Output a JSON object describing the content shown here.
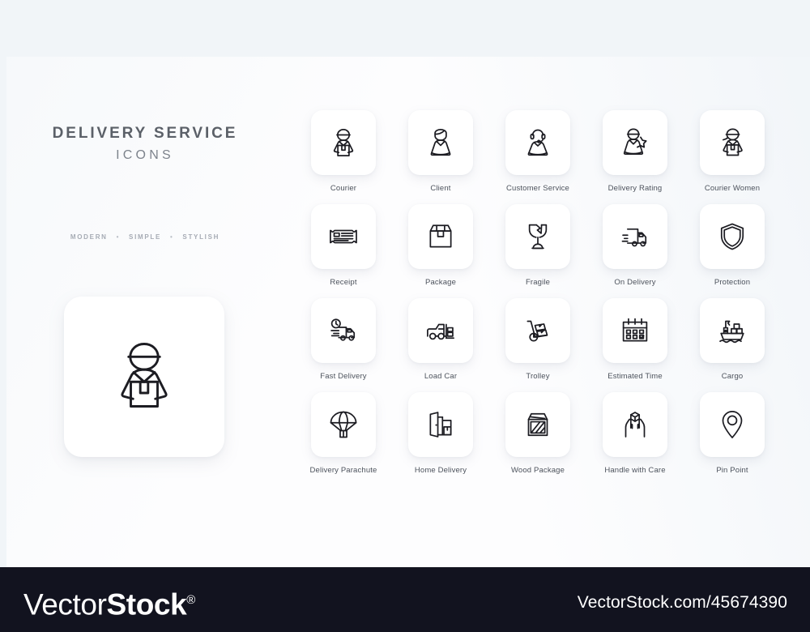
{
  "palette": {
    "top_band": "#f1f5f8",
    "canvas": "#fdfdfe",
    "tile": "#ffffff",
    "stroke": "#1c1c22",
    "label": "#4c525c",
    "title": "#5b6068",
    "footer_bg": "#12131f",
    "footer_text": "#ffffff"
  },
  "promo": {
    "title": "DELIVERY SERVICE",
    "subtitle": "ICONS",
    "tags": [
      "MODERN",
      "SIMPLE",
      "STYLISH"
    ],
    "separator": "•",
    "hero_icon_name": "courier-icon"
  },
  "grid": {
    "columns": 5,
    "rows": 4,
    "items": [
      {
        "label": "Courier",
        "icon": "courier-icon"
      },
      {
        "label": "Client",
        "icon": "client-icon"
      },
      {
        "label": "Customer Service",
        "icon": "customer-service-icon"
      },
      {
        "label": "Delivery Rating",
        "icon": "delivery-rating-icon"
      },
      {
        "label": "Courier Women",
        "icon": "courier-women-icon"
      },
      {
        "label": "Receipt",
        "icon": "receipt-icon"
      },
      {
        "label": "Package",
        "icon": "package-icon"
      },
      {
        "label": "Fragile",
        "icon": "fragile-icon"
      },
      {
        "label": "On Delivery",
        "icon": "on-delivery-truck-icon"
      },
      {
        "label": "Protection",
        "icon": "shield-icon"
      },
      {
        "label": "Fast Delivery",
        "icon": "fast-delivery-truck-icon"
      },
      {
        "label": "Load Car",
        "icon": "load-car-icon"
      },
      {
        "label": "Trolley",
        "icon": "trolley-icon"
      },
      {
        "label": "Estimated Time",
        "icon": "calendar-icon"
      },
      {
        "label": "Cargo",
        "icon": "cargo-ship-icon"
      },
      {
        "label": "Delivery Parachute",
        "icon": "parachute-icon"
      },
      {
        "label": "Home Delivery",
        "icon": "home-delivery-door-icon"
      },
      {
        "label": "Wood Package",
        "icon": "wood-crate-icon"
      },
      {
        "label": "Handle with Care",
        "icon": "handle-with-care-icon"
      },
      {
        "label": "Pin Point",
        "icon": "map-pin-icon"
      }
    ]
  },
  "footer": {
    "logo_thin": "Vector",
    "logo_bold": "Stock",
    "logo_mark": "®",
    "url": "VectorStock.com/45674390"
  }
}
